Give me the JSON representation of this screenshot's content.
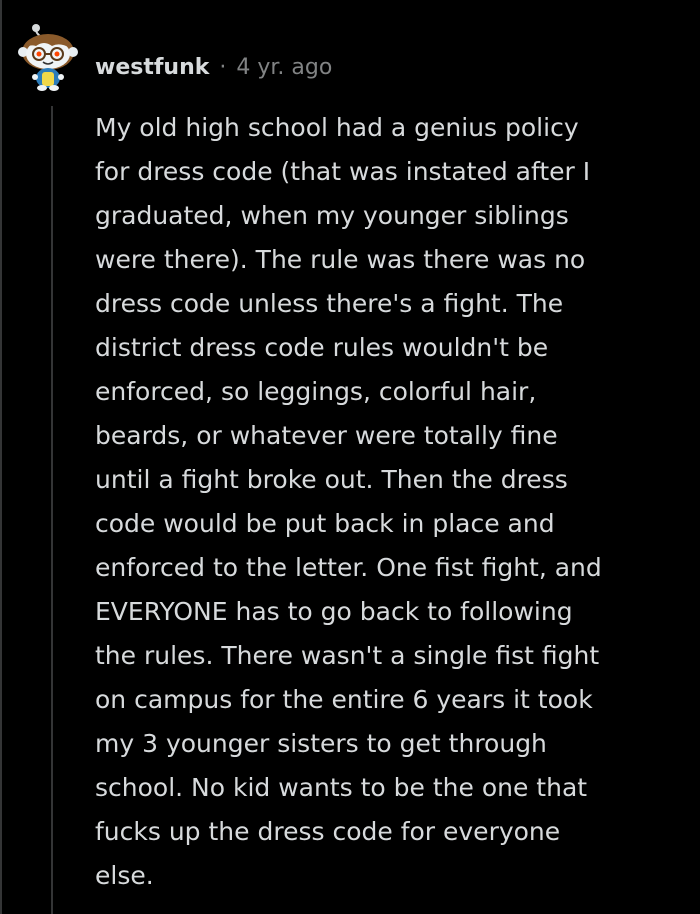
{
  "comment": {
    "username": "westfunk",
    "separator": "·",
    "timestamp": "4 yr. ago",
    "avatar_icon": "snoo-avatar-icon",
    "body_lines": [
      "My old high school had a genius policy",
      "for dress code (that was instated after I",
      "graduated, when my younger siblings",
      "were there). The rule was there was no",
      "dress code unless there's a fight. The",
      "district dress code rules wouldn't be",
      "enforced, so leggings, colorful hair,",
      "beards, or whatever were totally fine",
      "until a fight broke out. Then the dress",
      "code would be put back in place and",
      "enforced to the letter. One fist fight, and",
      "EVERYONE has to go back to following",
      "the rules. There wasn't a single fist fight",
      "on campus for the entire 6 years it took",
      "my 3 younger sisters to get through",
      "school. No kid wants to be the one that",
      "fucks up the dress code for everyone",
      "else."
    ]
  },
  "colors": {
    "background": "#000000",
    "text": "#d7dadc",
    "meta_text": "#818384",
    "thread_line": "#343536"
  }
}
